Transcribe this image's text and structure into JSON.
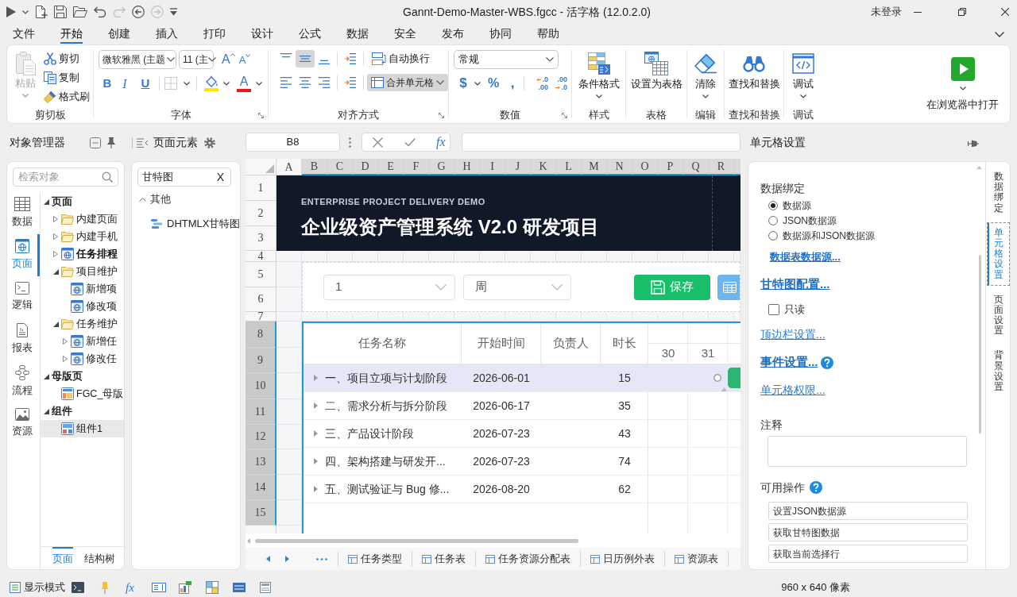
{
  "window": {
    "title": "Gannt-Demo-Master-WBS.fgcc - 活字格 (12.0.2.0)",
    "account": "未登录"
  },
  "quick_access": [
    {
      "kind": "run",
      "disabled": false
    },
    {
      "kind": "run_menu",
      "disabled": false
    },
    {
      "kind": "new",
      "disabled": false
    },
    {
      "kind": "save",
      "disabled": false
    },
    {
      "kind": "open",
      "disabled": false
    },
    {
      "kind": "undo",
      "disabled": false
    },
    {
      "kind": "redo",
      "disabled": true
    },
    {
      "kind": "back",
      "disabled": false
    },
    {
      "kind": "forward",
      "disabled": true
    },
    {
      "kind": "customize",
      "disabled": false
    }
  ],
  "menu_tabs": [
    {
      "label": "文件",
      "selected": false
    },
    {
      "label": "开始",
      "selected": true
    },
    {
      "label": "创建",
      "selected": false
    },
    {
      "label": "插入",
      "selected": false
    },
    {
      "label": "打印",
      "selected": false
    },
    {
      "label": "设计",
      "selected": false
    },
    {
      "label": "公式",
      "selected": false
    },
    {
      "label": "数据",
      "selected": false
    },
    {
      "label": "安全",
      "selected": false
    },
    {
      "label": "发布",
      "selected": false
    },
    {
      "label": "协同",
      "selected": false
    },
    {
      "label": "帮助",
      "selected": false
    }
  ],
  "ribbon": {
    "clipboard": {
      "title": "剪切板",
      "paste": {
        "label": "粘贴",
        "disabled": true
      },
      "actions": [
        {
          "kind": "cut",
          "label": "剪切"
        },
        {
          "kind": "copy",
          "label": "复制"
        },
        {
          "kind": "painter",
          "label": "格式刷"
        }
      ]
    },
    "font": {
      "title": "字体",
      "font_name": "微软雅黑 (主题",
      "font_size": "11 (主",
      "grow": "A",
      "shrink": "A",
      "bold": "B",
      "italic": "I",
      "underline": "U",
      "font_color": "A"
    },
    "alignment": {
      "title": "对齐方式",
      "buttons": [
        {
          "kind": "top",
          "selected": false
        },
        {
          "kind": "middle",
          "selected": true
        },
        {
          "kind": "bottom",
          "selected": false
        },
        {
          "kind": "left",
          "selected": false
        },
        {
          "kind": "center",
          "selected": false
        },
        {
          "kind": "right",
          "selected": false
        }
      ],
      "wrap": {
        "label": "自动换行",
        "selected": false
      },
      "merge": {
        "label": "合并单元格",
        "selected": true
      }
    },
    "number": {
      "title": "数值",
      "format": "常规",
      "currency": "$",
      "percent": "%",
      "comma": ",",
      "decimals": [
        {
          "kind": "increase",
          "lines": [
            ".0",
            ".00"
          ]
        },
        {
          "kind": "decrease",
          "lines": [
            ".00",
            ".0"
          ]
        }
      ]
    },
    "groups": [
      {
        "kind": "conditional_format",
        "title": "样式",
        "label": "条件格式",
        "dropdown": true
      },
      {
        "kind": "table",
        "title": "表格",
        "label": "设置为表格",
        "dropdown": false
      },
      {
        "kind": "clear",
        "title": "编辑",
        "label": "清除",
        "dropdown": true
      },
      {
        "kind": "find",
        "title": "查找和替换",
        "label": "查找和替换",
        "dropdown": false
      },
      {
        "kind": "debug",
        "title": "调试",
        "label": "调试",
        "dropdown": true
      }
    ],
    "open_in_browser": {
      "label": "在浏览器中打开",
      "dropdown": true
    }
  },
  "object_manager": {
    "title": "对象管理器",
    "search": {
      "placeholder": "检索对象"
    },
    "nav": [
      {
        "kind": "data",
        "label": "数据",
        "selected": false
      },
      {
        "kind": "page",
        "label": "页面",
        "selected": true
      },
      {
        "kind": "logic",
        "label": "逻辑",
        "selected": false
      },
      {
        "kind": "report",
        "label": "报表",
        "selected": false
      },
      {
        "kind": "flow",
        "label": "流程",
        "selected": false
      },
      {
        "kind": "resource",
        "label": "资源",
        "selected": false
      }
    ],
    "tree": [
      {
        "label": "页面",
        "kind": "section",
        "expanded": true,
        "selected": false,
        "emphasized": false,
        "children": [
          {
            "label": "内建页面",
            "kind": "folder",
            "expanded": false,
            "selected": false,
            "emphasized": false
          },
          {
            "label": "内建手机",
            "kind": "folder",
            "expanded": false,
            "selected": false,
            "emphasized": false
          },
          {
            "label": "任务排程",
            "kind": "page",
            "expanded": false,
            "selected": false,
            "emphasized": true
          },
          {
            "label": "项目维护",
            "kind": "folder",
            "expanded": true,
            "selected": false,
            "emphasized": false,
            "children": [
              {
                "label": "新增项",
                "kind": "page",
                "selected": false,
                "emphasized": false
              },
              {
                "label": "修改项",
                "kind": "page",
                "selected": false,
                "emphasized": false
              }
            ]
          },
          {
            "label": "任务维护",
            "kind": "folder",
            "expanded": true,
            "selected": false,
            "emphasized": false,
            "children": [
              {
                "label": "新增任",
                "kind": "page",
                "expanded": false,
                "selected": false,
                "emphasized": false
              },
              {
                "label": "修改任",
                "kind": "page",
                "expanded": false,
                "selected": false,
                "emphasized": false
              }
            ]
          }
        ]
      },
      {
        "label": "母版页",
        "kind": "section",
        "expanded": true,
        "selected": false,
        "emphasized": false,
        "children": [
          {
            "label": "FGC_母版",
            "kind": "master",
            "selected": false,
            "emphasized": false
          }
        ]
      },
      {
        "label": "组件",
        "kind": "section",
        "expanded": true,
        "selected": false,
        "emphasized": false,
        "children": [
          {
            "label": "组件1",
            "kind": "component",
            "selected": true,
            "emphasized": false
          }
        ]
      }
    ],
    "bottom_tabs": [
      {
        "label": "页面",
        "selected": true
      },
      {
        "label": "结构树",
        "selected": false
      }
    ]
  },
  "page_elements": {
    "title": "页面元素",
    "search": {
      "value": "甘特图",
      "clear": "X"
    },
    "groups": [
      {
        "label": "其他",
        "expanded": true,
        "items": [
          {
            "label": "DHTMLX甘特图"
          }
        ]
      }
    ]
  },
  "formula_bar": {
    "name_box": "B8",
    "function": "fx"
  },
  "sheet": {
    "columns": [
      {
        "label": "A",
        "selected": false
      },
      {
        "label": "B",
        "selected": true
      },
      {
        "label": "C",
        "selected": true
      },
      {
        "label": "D",
        "selected": true
      },
      {
        "label": "E",
        "selected": true
      },
      {
        "label": "F",
        "selected": true
      },
      {
        "label": "G",
        "selected": true
      },
      {
        "label": "H",
        "selected": true
      },
      {
        "label": "I",
        "selected": true
      },
      {
        "label": "J",
        "selected": true
      },
      {
        "label": "K",
        "selected": true
      },
      {
        "label": "L",
        "selected": true
      },
      {
        "label": "M",
        "selected": true
      },
      {
        "label": "N",
        "selected": true
      },
      {
        "label": "O",
        "selected": true
      },
      {
        "label": "P",
        "selected": true
      },
      {
        "label": "Q",
        "selected": true
      },
      {
        "label": "R",
        "selected": true
      }
    ],
    "rows": [
      {
        "label": "1",
        "selected": false
      },
      {
        "label": "2",
        "selected": false
      },
      {
        "label": "3",
        "selected": false
      },
      {
        "label": "4",
        "selected": false
      },
      {
        "label": "5",
        "selected": false
      },
      {
        "label": "6",
        "selected": false
      },
      {
        "label": "7",
        "selected": false
      },
      {
        "label": "8",
        "selected": true
      },
      {
        "label": "9",
        "selected": true
      },
      {
        "label": "10",
        "selected": true
      },
      {
        "label": "11",
        "selected": true
      },
      {
        "label": "12",
        "selected": true
      },
      {
        "label": "13",
        "selected": true
      },
      {
        "label": "14",
        "selected": true
      },
      {
        "label": "15",
        "selected": true
      }
    ],
    "banner": {
      "eyebrow": "ENTERPRISE PROJECT DELIVERY DEMO",
      "title": "企业级资产管理系统 V2.0 研发项目"
    },
    "filters": {
      "dropdowns": [
        {
          "value": "1"
        },
        {
          "value": "周"
        }
      ],
      "save": "保存"
    },
    "gantt": {
      "columns": [
        "任务名称",
        "开始时间",
        "负责人",
        "时长"
      ],
      "scale": [
        "30",
        "31"
      ],
      "rows": [
        {
          "name": "一、项目立项与计划阶段",
          "start": "2026-06-01",
          "duration": "15",
          "expanded": false,
          "selected": true,
          "bar_visible": true
        },
        {
          "name": "二、需求分析与拆分阶段",
          "start": "2026-06-17",
          "duration": "35",
          "expanded": false,
          "selected": false,
          "bar_visible": false
        },
        {
          "name": "三、产品设计阶段",
          "start": "2026-07-23",
          "duration": "43",
          "expanded": false,
          "selected": false,
          "bar_visible": false
        },
        {
          "name": "四、架构搭建与研发开...",
          "start": "2026-07-23",
          "duration": "74",
          "expanded": false,
          "selected": false,
          "bar_visible": false
        },
        {
          "name": "五、测试验证与 Bug 修...",
          "start": "2026-08-20",
          "duration": "62",
          "expanded": false,
          "selected": false,
          "bar_visible": false
        }
      ]
    }
  },
  "sheet_tabs": [
    "任务类型",
    "任务表",
    "任务资源分配表",
    "日历例外表",
    "资源表"
  ],
  "cell_settings": {
    "title": "单元格设置",
    "side_tabs": [
      {
        "label": "数据绑定",
        "selected": false
      },
      {
        "label": "单元格设置",
        "selected": true
      },
      {
        "label": "页面设置",
        "selected": false
      },
      {
        "label": "背景设置",
        "selected": false
      }
    ],
    "sections": [
      {
        "kind": "heading",
        "text": "数据绑定"
      },
      {
        "kind": "radios",
        "options": [
          {
            "label": "数据源",
            "selected": true
          },
          {
            "label": "JSON数据源",
            "selected": false
          },
          {
            "label": "数据源和JSON数据源",
            "selected": false
          }
        ],
        "link": "数据表数据源..."
      },
      {
        "kind": "link",
        "text": "甘特图配置...",
        "strong": true
      },
      {
        "kind": "checkbox",
        "label": "只读",
        "checked": false
      },
      {
        "kind": "link",
        "text": "顶边栏设置...",
        "strong": false
      },
      {
        "kind": "link",
        "text": "事件设置...",
        "strong": true,
        "help": true
      },
      {
        "kind": "link",
        "text": "单元格权限...",
        "strong": false
      },
      {
        "kind": "heading",
        "text": "注释"
      },
      {
        "kind": "textarea"
      },
      {
        "kind": "heading",
        "text": "可用操作",
        "help": true
      },
      {
        "kind": "actions",
        "items": [
          "设置JSON数据源",
          "获取甘特图数据",
          "获取当前选择行"
        ]
      }
    ]
  },
  "status_bar": {
    "display_mode": "显示模式",
    "function": "fx",
    "size": "960 x 640 像素"
  }
}
